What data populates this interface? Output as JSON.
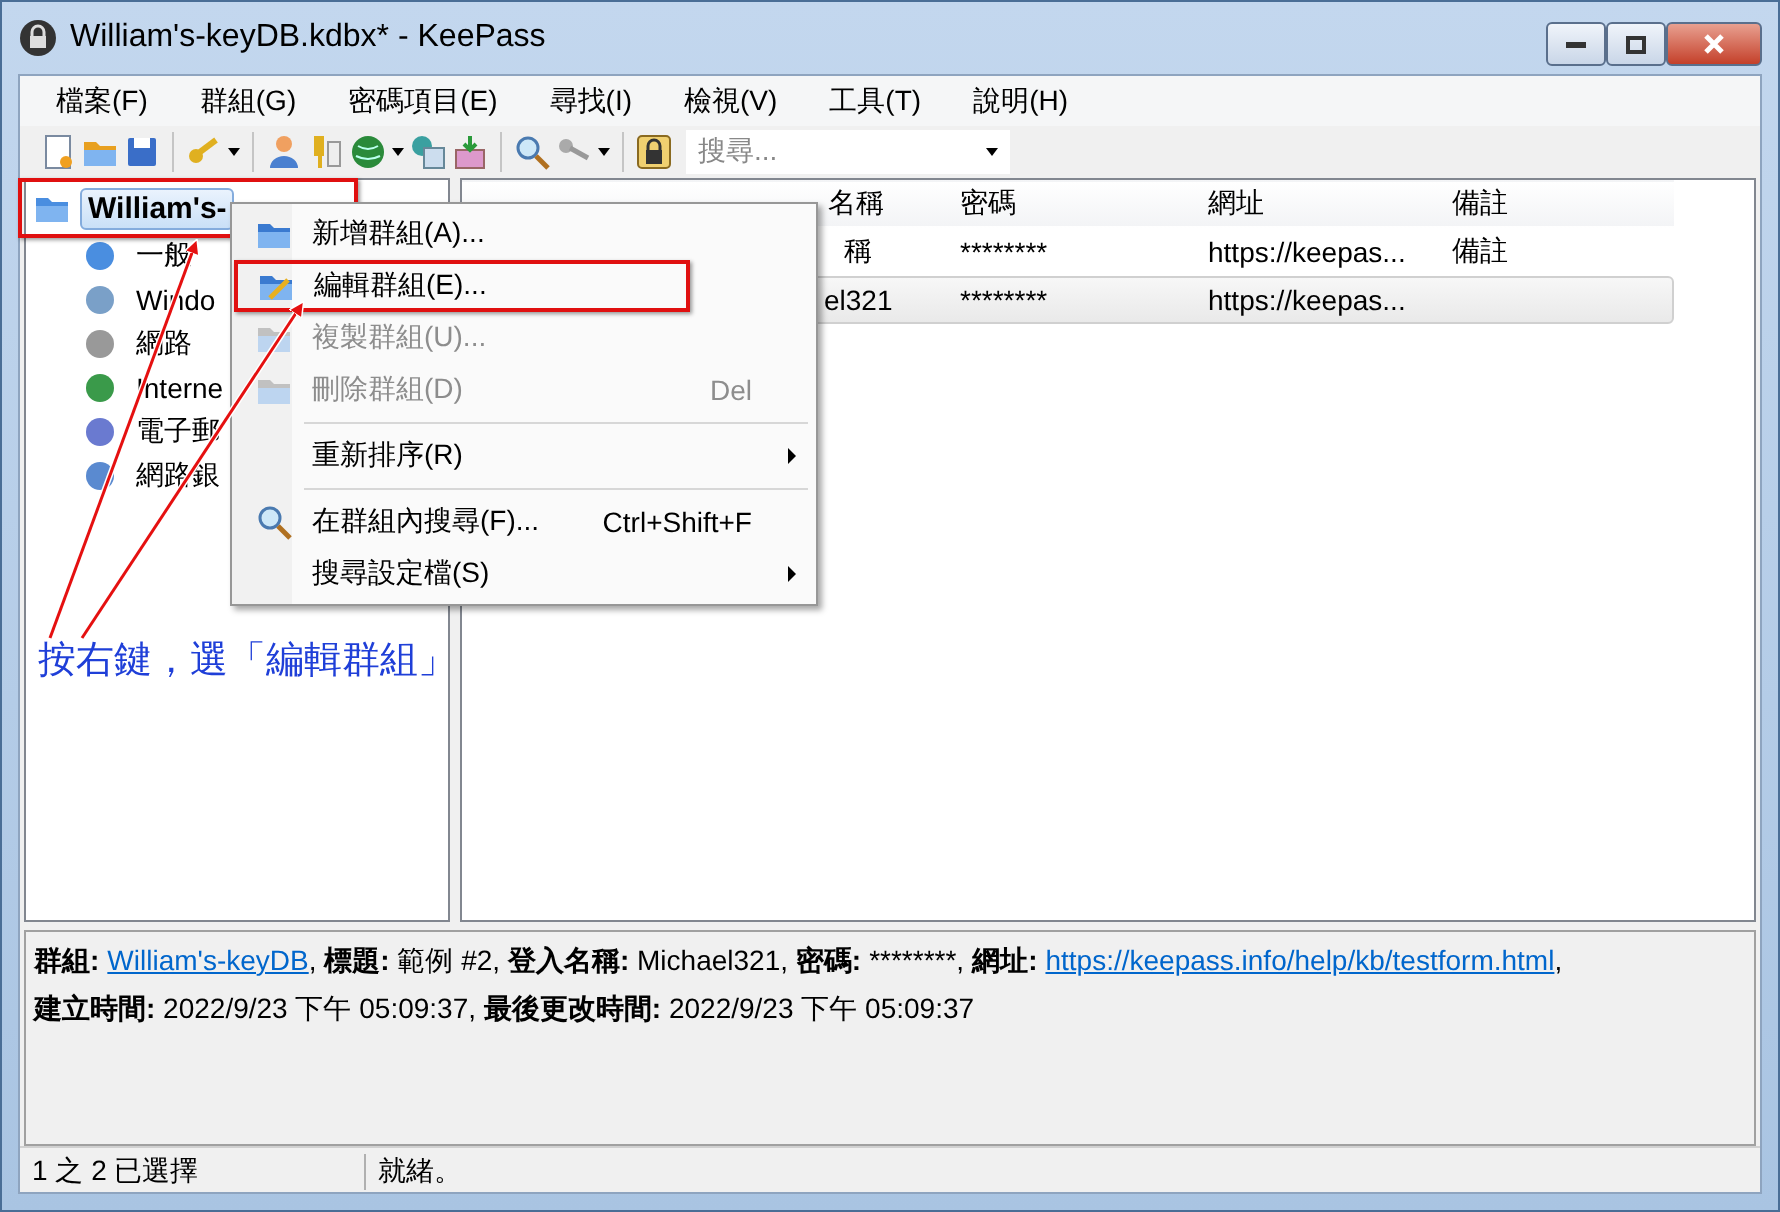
{
  "window": {
    "title": "William's-keyDB.kdbx* - KeePass"
  },
  "menu_bar": [
    "檔案(F)",
    "群組(G)",
    "密碼項目(E)",
    "尋找(I)",
    "檢視(V)",
    "工具(T)",
    "說明(H)"
  ],
  "toolbar": {
    "search": {
      "placeholder": "搜尋..."
    }
  },
  "tree": {
    "items": [
      {
        "label": "William's-",
        "selected": true,
        "children": [
          {
            "label": "一般",
            "selected": false
          },
          {
            "label": "Windo",
            "selected": false
          },
          {
            "label": "網路",
            "selected": false
          },
          {
            "label": "Interne",
            "selected": false
          },
          {
            "label": "電子郵",
            "selected": false
          },
          {
            "label": "網路銀",
            "selected": false
          }
        ]
      }
    ]
  },
  "table": {
    "columns": [
      "名稱",
      "密碼",
      "網址",
      "備註"
    ],
    "rows": [
      {
        "selected": false,
        "cells": [
          "稱",
          "********",
          "https://keepas...",
          "備註"
        ]
      },
      {
        "selected": true,
        "cells": [
          "el321",
          "********",
          "https://keepas...",
          ""
        ]
      }
    ]
  },
  "context_menu": [
    {
      "kind": "item",
      "label": "新增群組(A)...",
      "disabled": false
    },
    {
      "kind": "item",
      "label": "編輯群組(E)...",
      "disabled": false,
      "framed": true
    },
    {
      "kind": "item",
      "label": "複製群組(U)...",
      "disabled": true
    },
    {
      "kind": "item",
      "label": "刪除群組(D)",
      "shortcut": "Del",
      "disabled": true
    },
    {
      "kind": "separator"
    },
    {
      "kind": "submenu",
      "label": "重新排序(R)",
      "disabled": false
    },
    {
      "kind": "separator"
    },
    {
      "kind": "item",
      "label": "在群組內搜尋(F)...",
      "shortcut": "Ctrl+Shift+F",
      "disabled": false
    },
    {
      "kind": "submenu",
      "label": "搜尋設定檔(S)",
      "disabled": false
    }
  ],
  "annotation": "按右鍵，選「編輯群組」",
  "details": [
    [
      {
        "kind": "text",
        "text": "**群組:**"
      },
      {
        "kind": "link",
        "text": "William's-keyDB"
      },
      {
        "kind": "text",
        "text": ", **標題:** 範例 #2, **登入名稱:** Michael321, **密碼:**"
      },
      {
        "kind": "raw",
        "text": "********,"
      },
      {
        "kind": "text",
        "text": "**網址:**"
      },
      {
        "kind": "link",
        "text": "https://keepass.info/help/kb/testform.html"
      },
      {
        "kind": "text",
        "text": ","
      }
    ],
    [
      {
        "kind": "text",
        "text": "**建立時間:** 2022/9/23 下午 05:09:37, **最後更改時間:** 2022/9/23 下午 05:09:37"
      }
    ]
  ],
  "status_bar": [
    "1 之 2 已選擇",
    "就緒。"
  ]
}
